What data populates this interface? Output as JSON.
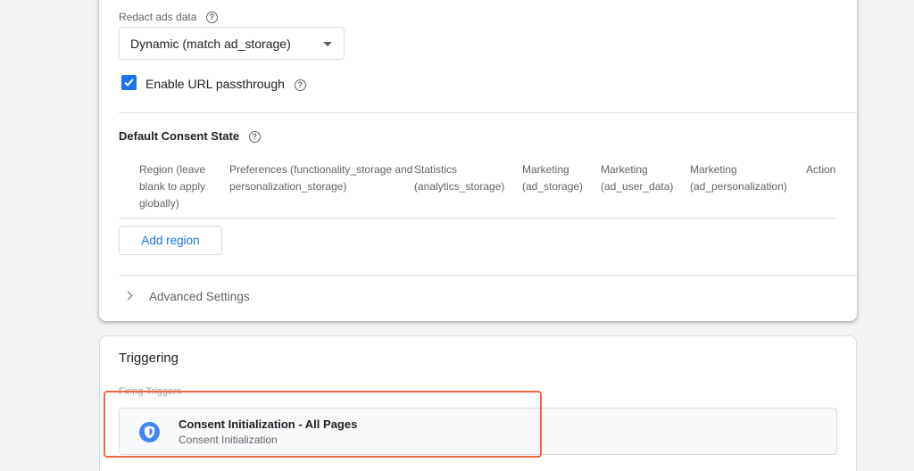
{
  "consent_card": {
    "redact_label": "Redact ads data",
    "redact_value": "Dynamic (match ad_storage)",
    "url_passthrough_label": "Enable URL passthrough",
    "url_passthrough_checked": true,
    "default_state_title": "Default Consent State",
    "columns": [
      [
        "Region (leave",
        "blank to apply",
        "globally)"
      ],
      [
        "Preferences (functionality_storage and",
        "personalization_storage)"
      ],
      [
        "Statistics",
        "(analytics_storage)"
      ],
      [
        "Marketing",
        "(ad_storage)"
      ],
      [
        "Marketing",
        "(ad_user_data)"
      ],
      [
        "Marketing",
        "(ad_personalization)"
      ],
      [
        "Action"
      ]
    ],
    "add_region_label": "Add region",
    "advanced_settings_label": "Advanced Settings"
  },
  "triggering": {
    "title": "Triggering",
    "firing_label": "Firing Triggers",
    "trigger": {
      "name": "Consent Initialization - All Pages",
      "type": "Consent Initialization"
    }
  },
  "colors": {
    "accent": "#1a73e8",
    "highlight": "#f0663f",
    "trigger_icon": "#4285f4"
  },
  "icons": {
    "help": "help-circle-icon",
    "dropdown": "dropdown-arrow-icon",
    "check": "check-icon",
    "chevron": "chevron-right-icon",
    "trigger": "shield-icon"
  }
}
